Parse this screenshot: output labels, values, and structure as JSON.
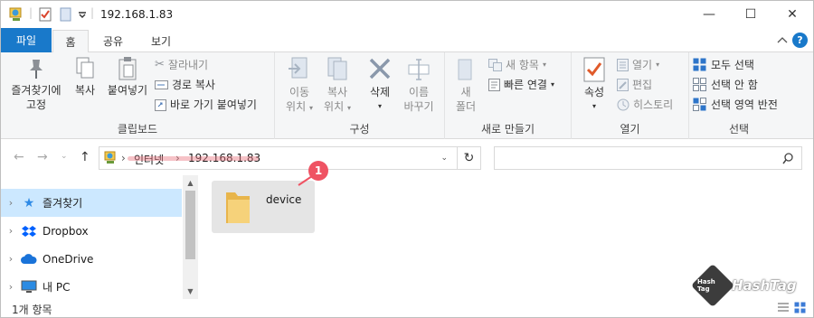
{
  "window": {
    "title": "192.168.1.83",
    "controls": {
      "minimize": "—",
      "maximize": "☐",
      "close": "✕"
    }
  },
  "tabs": [
    {
      "label": "파일"
    },
    {
      "label": "홈"
    },
    {
      "label": "공유"
    },
    {
      "label": "보기"
    }
  ],
  "ribbon": {
    "clipboard": {
      "pin_label_1": "즐겨찾기에",
      "pin_label_2": "고정",
      "copy": "복사",
      "paste": "붙여넣기",
      "cut": "잘라내기",
      "copy_path": "경로 복사",
      "paste_shortcut": "바로 가기 붙여넣기",
      "group": "클립보드"
    },
    "organize": {
      "move_1": "이동",
      "move_2": "위치",
      "copyto_1": "복사",
      "copyto_2": "위치",
      "delete": "삭제",
      "rename_1": "이름",
      "rename_2": "바꾸기",
      "group": "구성"
    },
    "new": {
      "new_folder_1": "새",
      "new_folder_2": "폴더",
      "new_item": "새 항목",
      "easy_access": "빠른 연결",
      "group": "새로 만들기"
    },
    "open": {
      "properties": "속성",
      "open": "열기",
      "edit": "편집",
      "history": "히스토리",
      "group": "열기"
    },
    "select": {
      "select_all": "모두 선택",
      "select_none": "선택 안 함",
      "invert": "선택 영역 반전",
      "group": "선택"
    }
  },
  "address": {
    "root": "인터넷",
    "current": "192.168.1.83",
    "sep": "›"
  },
  "nav": {
    "items": [
      {
        "label": "즐겨찾기",
        "icon": "star-icon"
      },
      {
        "label": "Dropbox",
        "icon": "dropbox-icon"
      },
      {
        "label": "OneDrive",
        "icon": "cloud-icon"
      },
      {
        "label": "내 PC",
        "icon": "pc-icon"
      }
    ]
  },
  "content": {
    "items": [
      {
        "name": "device",
        "icon": "folder-icon"
      }
    ]
  },
  "annotation": {
    "badge": "1"
  },
  "status": {
    "count": "1개 항목"
  },
  "watermark": {
    "text": "HashTag",
    "box": "Hash Tag"
  }
}
